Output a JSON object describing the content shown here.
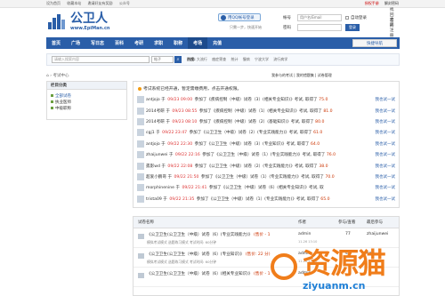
{
  "topbar": {
    "links": [
      "设为首页",
      "收藏本站",
      "邀请好友有奖励",
      "公众号"
    ],
    "right": [
      "授权手册",
      "解封密码"
    ]
  },
  "header": {
    "logo_cn": "公卫人",
    "logo_en": "www.EpiMan.cn",
    "qq_button": "用QQ帐号登录",
    "qq_sub": "只需一步，快速开始",
    "login": {
      "account_label": "帐号",
      "account_placeholder": "用户名/Email",
      "password_label": "密码",
      "auto_login": "自动登录",
      "login_button": "登录",
      "find_password": "找回密码",
      "register": "立即注册"
    }
  },
  "nav": {
    "items": [
      "首页",
      "广场",
      "写日志",
      "百科",
      "考研",
      "求职",
      "职称",
      "考场",
      "充值"
    ],
    "active_index": 7,
    "fast_nav": "快捷导航"
  },
  "search": {
    "placeholder": "请输入搜索内容",
    "select": "帖子",
    "hot_label": "热搜:",
    "hot": [
      "大流行",
      "癌症筛查",
      "统计",
      "慢病",
      "宁波大学",
      "流行病学"
    ]
  },
  "breadcrumb": "考试中心",
  "crumb_right": "我参与的考试 | 我的错题集 | 试卷管理",
  "sidebar": {
    "title": "栏目分类",
    "items": [
      "全部试卷",
      "执业医师",
      "中级职称"
    ]
  },
  "feed": {
    "header": "考试系统已经开通，暂定需缴费用，点击开通权限。",
    "action": "我也试一试",
    "rows": [
      {
        "user": "antjojo",
        "time": "09/23 09:00",
        "text": "参加了《疾病控制（中级）试卷（3）(相关专业知识)》考试, 取得了",
        "score": "75.0"
      },
      {
        "user": "2014考研",
        "time": "09/23 08:55",
        "text": "参加了《疾病控制（中级）试卷（1）(相关专业知识)》考试, 取得了",
        "score": "81.0"
      },
      {
        "user": "2014考研",
        "time": "09/23 08:10",
        "text": "参加了《疾病控制（中级）试卷（2）(基础知识)》考试, 取得了",
        "score": "80.0"
      },
      {
        "user": "cgj1",
        "time": "09/22 23:47",
        "text": "参加了《公卫卫生（中级）试卷（2）(专业实践能力)》考试, 取得了",
        "score": "61.0"
      },
      {
        "user": "antjojo",
        "time": "09/22 22:30",
        "text": "参加了《公卫卫生（中级）试卷（3）(专业知识)》考试, 取得了",
        "score": "64.0"
      },
      {
        "user": "zhaijunwei",
        "time": "09/22 22:16",
        "text": "参加了《公卫卫生（中级）试卷（1）(专业实践能力)》考试, 取得了",
        "score": "76.0"
      },
      {
        "user": "孤影wd",
        "time": "09/22 22:08",
        "text": "参加了《公卫卫生（中级）试卷（2）(专业实践能力)》考试, 取得了",
        "score": "38.0"
      },
      {
        "user": "超爱小鹏哥",
        "time": "09/22 21:50",
        "text": "参加了《公卫卫生（中级）试卷（1）(专业实践能力)》考试, 取得了",
        "score": "70.0"
      },
      {
        "user": "morphinenine",
        "time": "09/22 21:41",
        "text": "参加了《公卫卫生（中级）试卷（6）(相关专业知识)》考试, 取",
        "score": ""
      },
      {
        "user": "trista09",
        "time": "09/22 21:35",
        "text": "参加了《公卫卫生（中级）试卷（1）(专业实践能力)》考试, 取得了",
        "score": "65.0"
      }
    ]
  },
  "table": {
    "headers": [
      "试卷名称",
      "作者",
      "参与/查看",
      "最后参与"
    ],
    "rows": [
      {
        "title": "《公卫卫生(公卫卫生（中级）试卷（6）(专业实践能力)》",
        "tag": "(售价 - 1",
        "sub": "模拟考试模式    选题练习模式    考试时间: 60分钟",
        "author": "admin",
        "time": "11-26 13:10",
        "count": "77",
        "last": "zhaijunwei"
      },
      {
        "title": "《公卫卫生(公卫卫生（中级）试卷（6）(专业知识)》",
        "tag": "(售价: 22 分)",
        "sub": "模拟考试模式    选题练习模式    考试时间: 60分钟",
        "author": "admin",
        "time": "11-26 13:10",
        "count": "43",
        "last": "cgj1"
      },
      {
        "title": "《公卫卫生(公卫卫生（中级）试卷（6）(相关专业知识)》",
        "tag": "(售价 - 1",
        "sub": "",
        "author": "admin",
        "time": "",
        "count": "",
        "last": ""
      }
    ]
  },
  "watermark": {
    "text": "资源猫",
    "url": "ziyuanm.cn"
  },
  "colors": {
    "brand": "#2a5ea8",
    "score": "#c33300",
    "watermark": "#f07d1a"
  }
}
